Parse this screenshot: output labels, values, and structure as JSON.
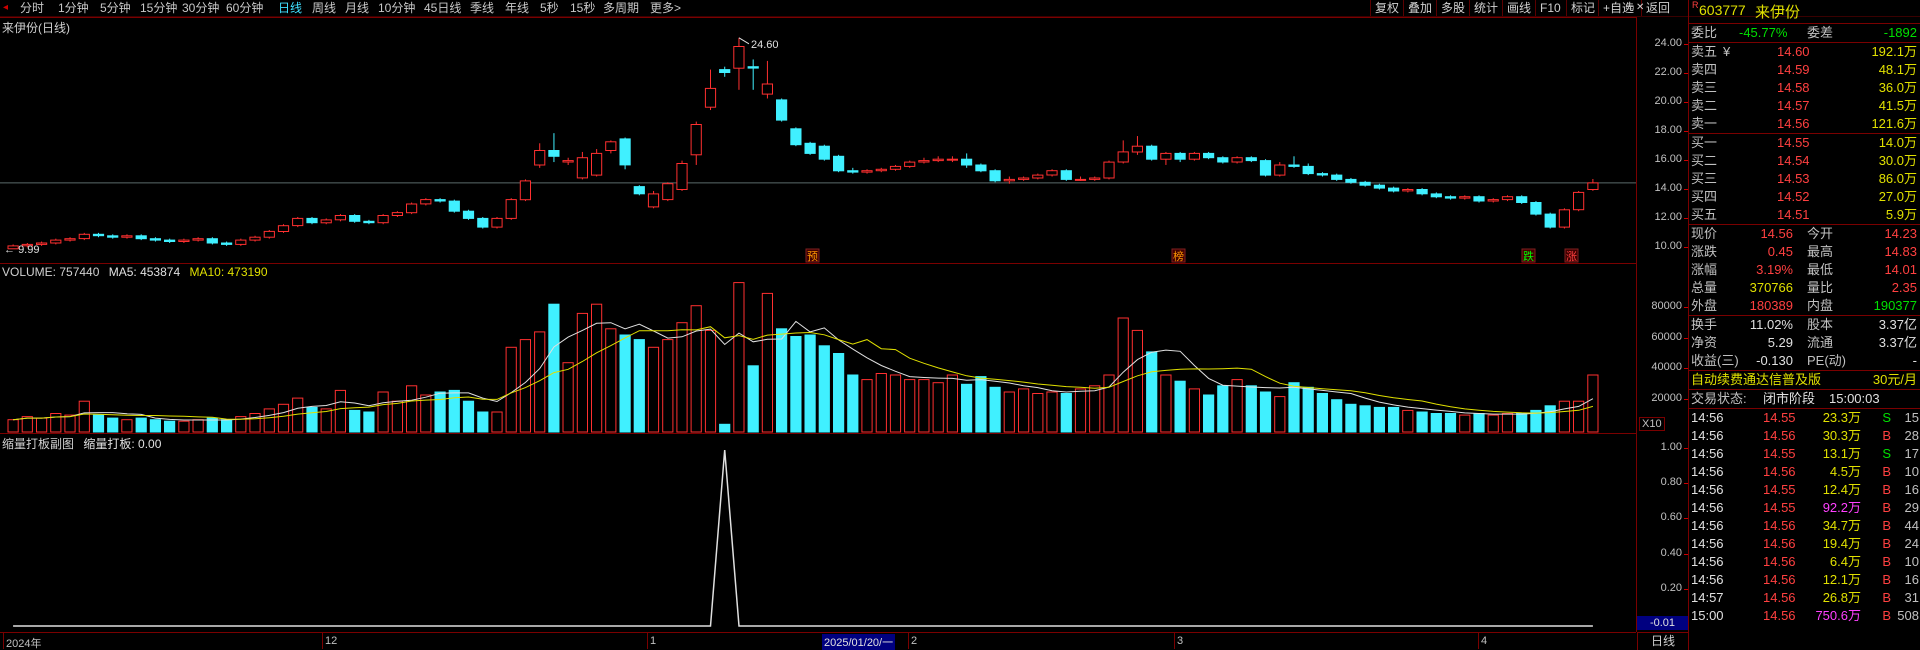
{
  "toolbar": {
    "periods": [
      "分时",
      "1分钟",
      "5分钟",
      "15分钟",
      "30分钟",
      "60分钟",
      "日线",
      "周线",
      "月线",
      "10分钟",
      "45日线",
      "季线",
      "年线",
      "5秒",
      "15秒",
      "多周期",
      "更多>"
    ],
    "active_period": "日线",
    "right_buttons": [
      "复权",
      "叠加",
      "多股",
      "统计",
      "画线",
      "F10",
      "标记",
      "+自选",
      "返回"
    ]
  },
  "main_chart": {
    "title": "来伊份(日线)",
    "high_label": "24.60",
    "low_label": "9.99",
    "y_ticks": [
      "24.00",
      "22.00",
      "20.00",
      "18.00",
      "16.00",
      "14.00",
      "12.00",
      "10.00"
    ],
    "badges": [
      "预",
      "榜",
      "跌",
      "涨"
    ],
    "colors": {
      "up": "#ff3030",
      "down": "#40f0ff",
      "ma": "#e0e0e0"
    }
  },
  "volume_chart": {
    "label_volume": "VOLUME: 757440",
    "label_ma5": "MA5: 453874",
    "label_ma10": "MA10: 473190",
    "y_ticks": [
      "80000",
      "60000",
      "40000",
      "20000"
    ],
    "unit": "X10"
  },
  "sub_chart": {
    "title": "缩量打板副图",
    "value_label": "缩量打板: 0.00",
    "y_ticks": [
      "1.00",
      "0.80",
      "0.60",
      "0.40",
      "0.20"
    ],
    "current_value": "-0.01"
  },
  "x_axis": {
    "labels": [
      "2024年",
      "12",
      "1",
      "2",
      "3",
      "4"
    ],
    "cursor_date": "2025/01/20/一",
    "right_label": "日线"
  },
  "quote": {
    "code": "603777",
    "name": "来伊份",
    "webi_label": "委比",
    "webi": "-45.77%",
    "weicha_label": "委差",
    "weicha": "-1892",
    "sell": [
      {
        "label": "卖五",
        "flag": "¥",
        "price": "14.60",
        "vol": "192.1万"
      },
      {
        "label": "卖四",
        "flag": "",
        "price": "14.59",
        "vol": "48.1万"
      },
      {
        "label": "卖三",
        "flag": "",
        "price": "14.58",
        "vol": "36.0万"
      },
      {
        "label": "卖二",
        "flag": "",
        "price": "14.57",
        "vol": "41.5万"
      },
      {
        "label": "卖一",
        "flag": "",
        "price": "14.56",
        "vol": "121.6万"
      }
    ],
    "buy": [
      {
        "label": "买一",
        "price": "14.55",
        "vol": "14.0万"
      },
      {
        "label": "买二",
        "price": "14.54",
        "vol": "30.0万"
      },
      {
        "label": "买三",
        "price": "14.53",
        "vol": "86.0万"
      },
      {
        "label": "买四",
        "price": "14.52",
        "vol": "27.0万"
      },
      {
        "label": "买五",
        "price": "14.51",
        "vol": "5.9万"
      }
    ],
    "stats": [
      {
        "l1": "现价",
        "v1": "14.56",
        "c1": "red",
        "l2": "今开",
        "v2": "14.23",
        "c2": "red"
      },
      {
        "l1": "涨跌",
        "v1": "0.45",
        "c1": "red",
        "l2": "最高",
        "v2": "14.83",
        "c2": "red"
      },
      {
        "l1": "涨幅",
        "v1": "3.19%",
        "c1": "red",
        "l2": "最低",
        "v2": "14.01",
        "c2": "red"
      },
      {
        "l1": "总量",
        "v1": "370766",
        "c1": "yellow",
        "l2": "量比",
        "v2": "2.35",
        "c2": "red"
      },
      {
        "l1": "外盘",
        "v1": "180389",
        "c1": "red",
        "l2": "内盘",
        "v2": "190377",
        "c2": "green"
      }
    ],
    "stats2": [
      {
        "l1": "换手",
        "v1": "11.02%",
        "l2": "股本",
        "v2": "3.37亿"
      },
      {
        "l1": "净资",
        "v1": "5.29",
        "l2": "流通",
        "v2": "3.37亿"
      },
      {
        "l1": "收益(三)",
        "v1": "-0.130",
        "l2": "PE(动)",
        "v2": "-"
      }
    ],
    "ad_text": "自动续费通达信普及版",
    "ad_price": "30元/月",
    "status_label": "交易状态:",
    "status_value": "闭市阶段",
    "status_time": "15:00:03",
    "ticks": [
      {
        "t": "14:56",
        "p": "14.55",
        "v": "23.3万",
        "bs": "S",
        "n": "15",
        "vc": "yellow"
      },
      {
        "t": "14:56",
        "p": "14.56",
        "v": "30.3万",
        "bs": "B",
        "n": "28",
        "vc": "yellow"
      },
      {
        "t": "14:56",
        "p": "14.55",
        "v": "13.1万",
        "bs": "S",
        "n": "17",
        "vc": "yellow"
      },
      {
        "t": "14:56",
        "p": "14.56",
        "v": "4.5万",
        "bs": "B",
        "n": "10",
        "vc": "yellow"
      },
      {
        "t": "14:56",
        "p": "14.55",
        "v": "12.4万",
        "bs": "B",
        "n": "16",
        "vc": "yellow"
      },
      {
        "t": "14:56",
        "p": "14.55",
        "v": "92.2万",
        "bs": "B",
        "n": "29",
        "vc": "mag"
      },
      {
        "t": "14:56",
        "p": "14.56",
        "v": "34.7万",
        "bs": "B",
        "n": "44",
        "vc": "yellow"
      },
      {
        "t": "14:56",
        "p": "14.56",
        "v": "19.4万",
        "bs": "B",
        "n": "24",
        "vc": "yellow"
      },
      {
        "t": "14:56",
        "p": "14.56",
        "v": "6.4万",
        "bs": "B",
        "n": "10",
        "vc": "yellow"
      },
      {
        "t": "14:56",
        "p": "14.56",
        "v": "12.1万",
        "bs": "B",
        "n": "16",
        "vc": "yellow"
      },
      {
        "t": "14:57",
        "p": "14.56",
        "v": "26.8万",
        "bs": "B",
        "n": "31",
        "vc": "yellow"
      },
      {
        "t": "15:00",
        "p": "14.56",
        "v": "750.6万",
        "bs": "B",
        "n": "508",
        "vc": "mag"
      }
    ]
  },
  "chart_data": {
    "type": "candlestick",
    "series": [
      {
        "o": 10.0,
        "c": 10.2,
        "h": 10.3,
        "l": 9.99,
        "v": 8000
      },
      {
        "o": 10.2,
        "c": 10.3,
        "h": 10.4,
        "l": 10.1,
        "v": 10000
      },
      {
        "o": 10.3,
        "c": 10.4,
        "h": 10.5,
        "l": 10.2,
        "v": 9000
      },
      {
        "o": 10.4,
        "c": 10.6,
        "h": 10.7,
        "l": 10.3,
        "v": 12000
      },
      {
        "o": 10.6,
        "c": 10.7,
        "h": 10.8,
        "l": 10.5,
        "v": 11000
      },
      {
        "o": 10.7,
        "c": 11.0,
        "h": 11.1,
        "l": 10.6,
        "v": 20000
      },
      {
        "o": 11.0,
        "c": 10.9,
        "h": 11.1,
        "l": 10.8,
        "v": 11000
      },
      {
        "o": 10.9,
        "c": 10.8,
        "h": 11.0,
        "l": 10.7,
        "v": 9000
      },
      {
        "o": 10.8,
        "c": 10.9,
        "h": 11.0,
        "l": 10.7,
        "v": 8000
      },
      {
        "o": 10.9,
        "c": 10.7,
        "h": 11.0,
        "l": 10.6,
        "v": 9000
      },
      {
        "o": 10.7,
        "c": 10.6,
        "h": 10.8,
        "l": 10.5,
        "v": 8000
      },
      {
        "o": 10.6,
        "c": 10.5,
        "h": 10.7,
        "l": 10.4,
        "v": 7000
      },
      {
        "o": 10.5,
        "c": 10.6,
        "h": 10.7,
        "l": 10.4,
        "v": 7000
      },
      {
        "o": 10.6,
        "c": 10.7,
        "h": 10.8,
        "l": 10.5,
        "v": 8000
      },
      {
        "o": 10.7,
        "c": 10.4,
        "h": 10.8,
        "l": 10.3,
        "v": 9000
      },
      {
        "o": 10.4,
        "c": 10.3,
        "h": 10.5,
        "l": 10.2,
        "v": 8000
      },
      {
        "o": 10.3,
        "c": 10.6,
        "h": 10.7,
        "l": 10.2,
        "v": 10000
      },
      {
        "o": 10.6,
        "c": 10.8,
        "h": 10.9,
        "l": 10.5,
        "v": 12000
      },
      {
        "o": 10.8,
        "c": 11.2,
        "h": 11.3,
        "l": 10.7,
        "v": 15000
      },
      {
        "o": 11.2,
        "c": 11.6,
        "h": 11.7,
        "l": 11.1,
        "v": 18000
      },
      {
        "o": 11.6,
        "c": 12.1,
        "h": 12.2,
        "l": 11.5,
        "v": 22000
      },
      {
        "o": 12.1,
        "c": 11.8,
        "h": 12.2,
        "l": 11.7,
        "v": 16000
      },
      {
        "o": 11.8,
        "c": 12.0,
        "h": 12.1,
        "l": 11.7,
        "v": 15000
      },
      {
        "o": 12.0,
        "c": 12.3,
        "h": 12.4,
        "l": 11.9,
        "v": 27000
      },
      {
        "o": 12.3,
        "c": 11.9,
        "h": 12.4,
        "l": 11.8,
        "v": 14000
      },
      {
        "o": 11.9,
        "c": 11.8,
        "h": 12.0,
        "l": 11.7,
        "v": 13000
      },
      {
        "o": 11.8,
        "c": 12.3,
        "h": 12.4,
        "l": 11.7,
        "v": 26000
      },
      {
        "o": 12.3,
        "c": 12.5,
        "h": 12.6,
        "l": 12.2,
        "v": 20000
      },
      {
        "o": 12.5,
        "c": 13.1,
        "h": 13.2,
        "l": 12.4,
        "v": 30000
      },
      {
        "o": 13.1,
        "c": 13.4,
        "h": 13.5,
        "l": 13.0,
        "v": 24000
      },
      {
        "o": 13.4,
        "c": 13.3,
        "h": 13.5,
        "l": 13.2,
        "v": 26000
      },
      {
        "o": 13.3,
        "c": 12.6,
        "h": 13.4,
        "l": 12.5,
        "v": 27000
      },
      {
        "o": 12.6,
        "c": 12.1,
        "h": 12.7,
        "l": 12.0,
        "v": 20000
      },
      {
        "o": 12.1,
        "c": 11.5,
        "h": 12.2,
        "l": 11.4,
        "v": 13000
      },
      {
        "o": 11.5,
        "c": 12.1,
        "h": 12.2,
        "l": 11.4,
        "v": 13000
      },
      {
        "o": 12.1,
        "c": 13.4,
        "h": 13.5,
        "l": 12.0,
        "v": 55000
      },
      {
        "o": 13.4,
        "c": 14.7,
        "h": 14.8,
        "l": 13.3,
        "v": 60000
      },
      {
        "o": 15.8,
        "c": 16.8,
        "h": 17.3,
        "l": 15.6,
        "v": 65000
      },
      {
        "o": 16.8,
        "c": 16.4,
        "h": 18.0,
        "l": 16.0,
        "v": 83000
      },
      {
        "o": 16.0,
        "c": 16.1,
        "h": 16.3,
        "l": 15.8,
        "v": 45000
      },
      {
        "o": 14.9,
        "c": 16.3,
        "h": 16.7,
        "l": 14.8,
        "v": 77000
      },
      {
        "o": 15.1,
        "c": 16.6,
        "h": 16.9,
        "l": 15.0,
        "v": 83000
      },
      {
        "o": 16.8,
        "c": 17.4,
        "h": 17.5,
        "l": 16.6,
        "v": 67000
      },
      {
        "o": 17.6,
        "c": 15.8,
        "h": 17.7,
        "l": 15.5,
        "v": 63000
      },
      {
        "o": 14.3,
        "c": 13.8,
        "h": 14.4,
        "l": 13.7,
        "v": 60000
      },
      {
        "o": 12.9,
        "c": 13.8,
        "h": 14.0,
        "l": 12.8,
        "v": 55000
      },
      {
        "o": 13.4,
        "c": 14.5,
        "h": 14.6,
        "l": 13.3,
        "v": 60000
      },
      {
        "o": 14.1,
        "c": 15.9,
        "h": 16.1,
        "l": 14.0,
        "v": 71000
      },
      {
        "o": 16.5,
        "c": 18.6,
        "h": 18.8,
        "l": 15.8,
        "v": 82000
      },
      {
        "o": 19.8,
        "c": 21.1,
        "h": 22.4,
        "l": 19.6,
        "v": 66000
      },
      {
        "o": 22.4,
        "c": 22.2,
        "h": 22.6,
        "l": 21.9,
        "v": 5000
      },
      {
        "o": 22.5,
        "c": 24.0,
        "h": 24.6,
        "l": 21.0,
        "v": 97000
      },
      {
        "o": 22.6,
        "c": 22.5,
        "h": 23.1,
        "l": 21.0,
        "v": 43000
      },
      {
        "o": 20.7,
        "c": 21.4,
        "h": 23.0,
        "l": 20.4,
        "v": 90000
      },
      {
        "o": 20.3,
        "c": 18.9,
        "h": 20.4,
        "l": 18.8,
        "v": 67000
      },
      {
        "o": 18.3,
        "c": 17.2,
        "h": 18.4,
        "l": 17.1,
        "v": 62000
      },
      {
        "o": 17.3,
        "c": 16.6,
        "h": 17.4,
        "l": 16.5,
        "v": 63000
      },
      {
        "o": 17.1,
        "c": 16.2,
        "h": 17.2,
        "l": 16.1,
        "v": 56000
      },
      {
        "o": 16.4,
        "c": 15.4,
        "h": 16.5,
        "l": 15.3,
        "v": 51000
      },
      {
        "o": 15.4,
        "c": 15.3,
        "h": 15.6,
        "l": 15.2,
        "v": 37000
      },
      {
        "o": 15.3,
        "c": 15.4,
        "h": 15.5,
        "l": 15.2,
        "v": 34000
      },
      {
        "o": 15.4,
        "c": 15.5,
        "h": 15.6,
        "l": 15.3,
        "v": 38000
      },
      {
        "o": 15.5,
        "c": 15.7,
        "h": 15.8,
        "l": 15.4,
        "v": 37000
      },
      {
        "o": 15.7,
        "c": 16.0,
        "h": 16.1,
        "l": 15.6,
        "v": 34000
      },
      {
        "o": 16.0,
        "c": 16.1,
        "h": 16.3,
        "l": 15.9,
        "v": 34000
      },
      {
        "o": 16.1,
        "c": 16.2,
        "h": 16.4,
        "l": 16.0,
        "v": 32000
      },
      {
        "o": 16.2,
        "c": 16.2,
        "h": 16.4,
        "l": 16.0,
        "v": 37000
      },
      {
        "o": 16.2,
        "c": 15.8,
        "h": 16.6,
        "l": 15.6,
        "v": 31000
      },
      {
        "o": 15.8,
        "c": 15.4,
        "h": 15.9,
        "l": 15.3,
        "v": 36000
      },
      {
        "o": 15.4,
        "c": 14.7,
        "h": 15.5,
        "l": 14.6,
        "v": 29000
      },
      {
        "o": 14.7,
        "c": 14.8,
        "h": 15.0,
        "l": 14.5,
        "v": 26000
      },
      {
        "o": 14.8,
        "c": 14.9,
        "h": 15.0,
        "l": 14.7,
        "v": 28000
      },
      {
        "o": 14.9,
        "c": 15.1,
        "h": 15.2,
        "l": 14.8,
        "v": 25000
      },
      {
        "o": 15.1,
        "c": 15.4,
        "h": 15.5,
        "l": 15.0,
        "v": 26000
      },
      {
        "o": 15.4,
        "c": 14.8,
        "h": 15.5,
        "l": 14.7,
        "v": 25000
      },
      {
        "o": 14.8,
        "c": 14.8,
        "h": 15.0,
        "l": 14.7,
        "v": 28000
      },
      {
        "o": 14.8,
        "c": 14.9,
        "h": 15.0,
        "l": 14.7,
        "v": 30000
      },
      {
        "o": 14.9,
        "c": 16.0,
        "h": 16.1,
        "l": 14.8,
        "v": 37000
      },
      {
        "o": 16.0,
        "c": 16.7,
        "h": 17.5,
        "l": 15.9,
        "v": 74000
      },
      {
        "o": 16.7,
        "c": 17.1,
        "h": 17.8,
        "l": 16.5,
        "v": 66000
      },
      {
        "o": 17.1,
        "c": 16.2,
        "h": 17.2,
        "l": 16.1,
        "v": 52000
      },
      {
        "o": 16.2,
        "c": 16.6,
        "h": 16.7,
        "l": 15.8,
        "v": 37000
      },
      {
        "o": 16.6,
        "c": 16.2,
        "h": 16.7,
        "l": 16.0,
        "v": 33000
      },
      {
        "o": 16.2,
        "c": 16.6,
        "h": 16.7,
        "l": 16.1,
        "v": 28000
      },
      {
        "o": 16.6,
        "c": 16.3,
        "h": 16.7,
        "l": 16.2,
        "v": 24000
      },
      {
        "o": 16.3,
        "c": 16.0,
        "h": 16.4,
        "l": 15.9,
        "v": 30000
      },
      {
        "o": 16.0,
        "c": 16.3,
        "h": 16.4,
        "l": 15.9,
        "v": 34000
      },
      {
        "o": 16.3,
        "c": 16.1,
        "h": 16.4,
        "l": 16.0,
        "v": 30000
      },
      {
        "o": 16.1,
        "c": 15.1,
        "h": 16.2,
        "l": 15.0,
        "v": 26000
      },
      {
        "o": 15.1,
        "c": 15.8,
        "h": 16.0,
        "l": 15.0,
        "v": 23000
      },
      {
        "o": 15.8,
        "c": 15.7,
        "h": 16.4,
        "l": 15.6,
        "v": 32000
      },
      {
        "o": 15.7,
        "c": 15.2,
        "h": 15.9,
        "l": 15.1,
        "v": 29000
      },
      {
        "o": 15.2,
        "c": 15.1,
        "h": 15.3,
        "l": 15.0,
        "v": 25000
      },
      {
        "o": 15.1,
        "c": 14.8,
        "h": 15.2,
        "l": 14.7,
        "v": 21000
      },
      {
        "o": 14.8,
        "c": 14.6,
        "h": 14.9,
        "l": 14.5,
        "v": 18000
      },
      {
        "o": 14.6,
        "c": 14.4,
        "h": 14.7,
        "l": 14.3,
        "v": 17000
      },
      {
        "o": 14.4,
        "c": 14.2,
        "h": 14.5,
        "l": 14.1,
        "v": 16000
      },
      {
        "o": 14.2,
        "c": 14.0,
        "h": 14.3,
        "l": 13.9,
        "v": 16000
      },
      {
        "o": 14.0,
        "c": 14.1,
        "h": 14.2,
        "l": 13.9,
        "v": 14000
      },
      {
        "o": 14.1,
        "c": 13.8,
        "h": 14.2,
        "l": 13.7,
        "v": 13000
      },
      {
        "o": 13.8,
        "c": 13.6,
        "h": 13.9,
        "l": 13.5,
        "v": 12000
      },
      {
        "o": 13.6,
        "c": 13.5,
        "h": 13.7,
        "l": 13.4,
        "v": 12000
      },
      {
        "o": 13.5,
        "c": 13.6,
        "h": 13.7,
        "l": 13.4,
        "v": 11000
      },
      {
        "o": 13.6,
        "c": 13.3,
        "h": 13.7,
        "l": 13.2,
        "v": 12000
      },
      {
        "o": 13.3,
        "c": 13.4,
        "h": 13.5,
        "l": 13.2,
        "v": 11000
      },
      {
        "o": 13.4,
        "c": 13.6,
        "h": 13.7,
        "l": 13.3,
        "v": 12000
      },
      {
        "o": 13.6,
        "c": 13.2,
        "h": 13.7,
        "l": 13.1,
        "v": 12000
      },
      {
        "o": 13.2,
        "c": 12.4,
        "h": 13.3,
        "l": 12.3,
        "v": 14000
      },
      {
        "o": 12.4,
        "c": 11.5,
        "h": 12.5,
        "l": 11.4,
        "v": 17000
      },
      {
        "o": 11.5,
        "c": 12.7,
        "h": 12.8,
        "l": 11.4,
        "v": 20000
      },
      {
        "o": 12.7,
        "c": 13.9,
        "h": 14.0,
        "l": 12.6,
        "v": 20000
      },
      {
        "o": 14.1,
        "c": 14.56,
        "h": 14.83,
        "l": 14.01,
        "v": 37000
      }
    ],
    "ylim": [
      9.5,
      25.0
    ],
    "vol_ylim": [
      0,
      100000
    ],
    "ref_line": 14.56,
    "sub_series_peak_index": 50
  }
}
